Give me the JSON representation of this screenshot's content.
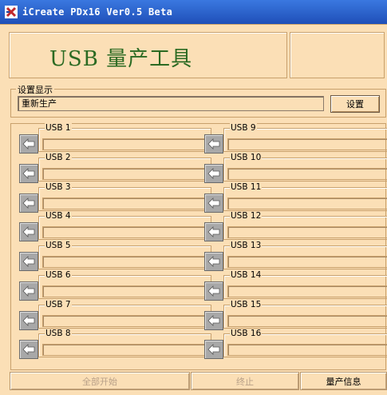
{
  "window": {
    "title": "iCreate PDx16 Ver0.5 Beta"
  },
  "banner": {
    "title": "USB 量产工具"
  },
  "settings": {
    "group_label": "设置显示",
    "display_value": "重新生产",
    "set_button": "设置"
  },
  "ports": [
    {
      "label": "USB 1"
    },
    {
      "label": "USB 2"
    },
    {
      "label": "USB 3"
    },
    {
      "label": "USB 4"
    },
    {
      "label": "USB 5"
    },
    {
      "label": "USB 6"
    },
    {
      "label": "USB 7"
    },
    {
      "label": "USB 8"
    },
    {
      "label": "USB 9"
    },
    {
      "label": "USB 10"
    },
    {
      "label": "USB 11"
    },
    {
      "label": "USB 12"
    },
    {
      "label": "USB 13"
    },
    {
      "label": "USB 14"
    },
    {
      "label": "USB 15"
    },
    {
      "label": "USB 16"
    }
  ],
  "footer": {
    "start_all": "全部开始",
    "stop": "终止",
    "info": "量产信息"
  },
  "colors": {
    "background": "#fbdfb6",
    "titlebar": "#2a5fc7",
    "banner_text": "#2b6a22"
  },
  "icons": {
    "app": "tools-icon",
    "port": "arrow-left-icon"
  }
}
